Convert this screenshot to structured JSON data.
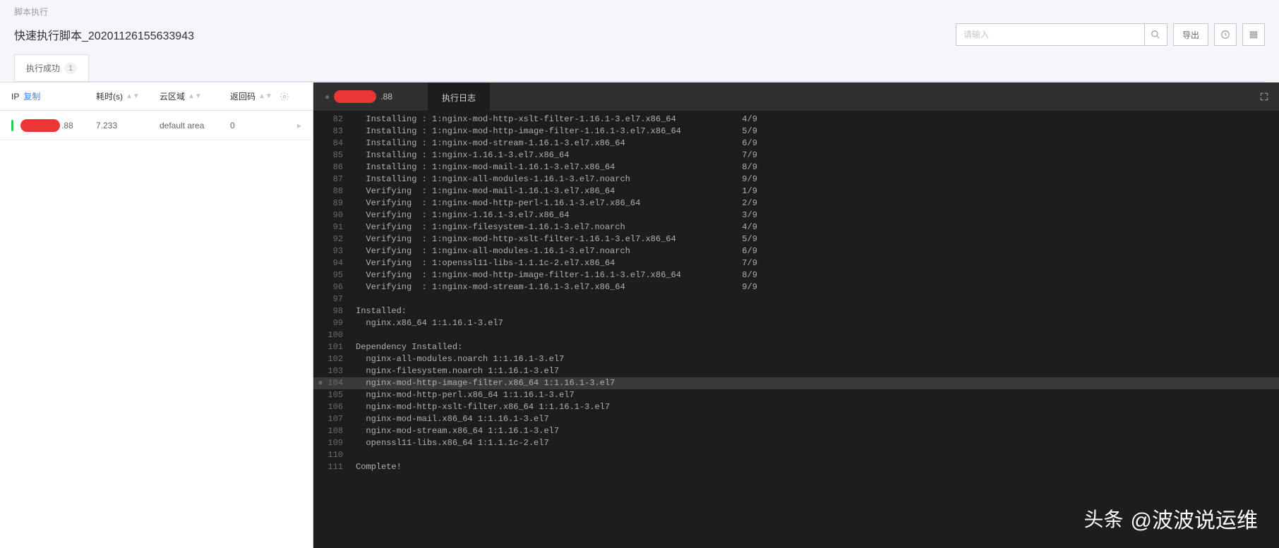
{
  "breadcrumb": "脚本执行",
  "page_title": "快速执行脚本_20201126155633943",
  "search": {
    "placeholder": "请输入"
  },
  "actions": {
    "export": "导出"
  },
  "tab": {
    "label": "执行成功",
    "count": "1"
  },
  "table": {
    "headers": {
      "ip": "IP",
      "copy": "复制",
      "duration": "耗时(s)",
      "zone": "云区域",
      "code": "返回码"
    },
    "row": {
      "ip_suffix": ".88",
      "duration": "7.233",
      "zone": "default area",
      "code": "0"
    }
  },
  "log_panel": {
    "host_suffix": ".88",
    "tab_label": "执行日志"
  },
  "log_lines": [
    {
      "n": 82,
      "t": "  Installing : 1:nginx-mod-http-xslt-filter-1.16.1-3.el7.x86_64             4/9"
    },
    {
      "n": 83,
      "t": "  Installing : 1:nginx-mod-http-image-filter-1.16.1-3.el7.x86_64            5/9"
    },
    {
      "n": 84,
      "t": "  Installing : 1:nginx-mod-stream-1.16.1-3.el7.x86_64                       6/9"
    },
    {
      "n": 85,
      "t": "  Installing : 1:nginx-1.16.1-3.el7.x86_64                                  7/9"
    },
    {
      "n": 86,
      "t": "  Installing : 1:nginx-mod-mail-1.16.1-3.el7.x86_64                         8/9"
    },
    {
      "n": 87,
      "t": "  Installing : 1:nginx-all-modules-1.16.1-3.el7.noarch                      9/9"
    },
    {
      "n": 88,
      "t": "  Verifying  : 1:nginx-mod-mail-1.16.1-3.el7.x86_64                         1/9"
    },
    {
      "n": 89,
      "t": "  Verifying  : 1:nginx-mod-http-perl-1.16.1-3.el7.x86_64                    2/9"
    },
    {
      "n": 90,
      "t": "  Verifying  : 1:nginx-1.16.1-3.el7.x86_64                                  3/9"
    },
    {
      "n": 91,
      "t": "  Verifying  : 1:nginx-filesystem-1.16.1-3.el7.noarch                       4/9"
    },
    {
      "n": 92,
      "t": "  Verifying  : 1:nginx-mod-http-xslt-filter-1.16.1-3.el7.x86_64             5/9"
    },
    {
      "n": 93,
      "t": "  Verifying  : 1:nginx-all-modules-1.16.1-3.el7.noarch                      6/9"
    },
    {
      "n": 94,
      "t": "  Verifying  : 1:openssl11-libs-1.1.1c-2.el7.x86_64                         7/9"
    },
    {
      "n": 95,
      "t": "  Verifying  : 1:nginx-mod-http-image-filter-1.16.1-3.el7.x86_64            8/9"
    },
    {
      "n": 96,
      "t": "  Verifying  : 1:nginx-mod-stream-1.16.1-3.el7.x86_64                       9/9"
    },
    {
      "n": 97,
      "t": ""
    },
    {
      "n": 98,
      "t": "Installed:"
    },
    {
      "n": 99,
      "t": "  nginx.x86_64 1:1.16.1-3.el7"
    },
    {
      "n": 100,
      "t": ""
    },
    {
      "n": 101,
      "t": "Dependency Installed:"
    },
    {
      "n": 102,
      "t": "  nginx-all-modules.noarch 1:1.16.1-3.el7"
    },
    {
      "n": 103,
      "t": "  nginx-filesystem.noarch 1:1.16.1-3.el7"
    },
    {
      "n": 104,
      "t": "  nginx-mod-http-image-filter.x86_64 1:1.16.1-3.el7",
      "hl": true
    },
    {
      "n": 105,
      "t": "  nginx-mod-http-perl.x86_64 1:1.16.1-3.el7"
    },
    {
      "n": 106,
      "t": "  nginx-mod-http-xslt-filter.x86_64 1:1.16.1-3.el7"
    },
    {
      "n": 107,
      "t": "  nginx-mod-mail.x86_64 1:1.16.1-3.el7"
    },
    {
      "n": 108,
      "t": "  nginx-mod-stream.x86_64 1:1.16.1-3.el7"
    },
    {
      "n": 109,
      "t": "  openssl11-libs.x86_64 1:1.1.1c-2.el7"
    },
    {
      "n": 110,
      "t": ""
    },
    {
      "n": 111,
      "t": "Complete!"
    }
  ],
  "watermark": {
    "prefix": "头条",
    "handle": "@波波说运维"
  }
}
